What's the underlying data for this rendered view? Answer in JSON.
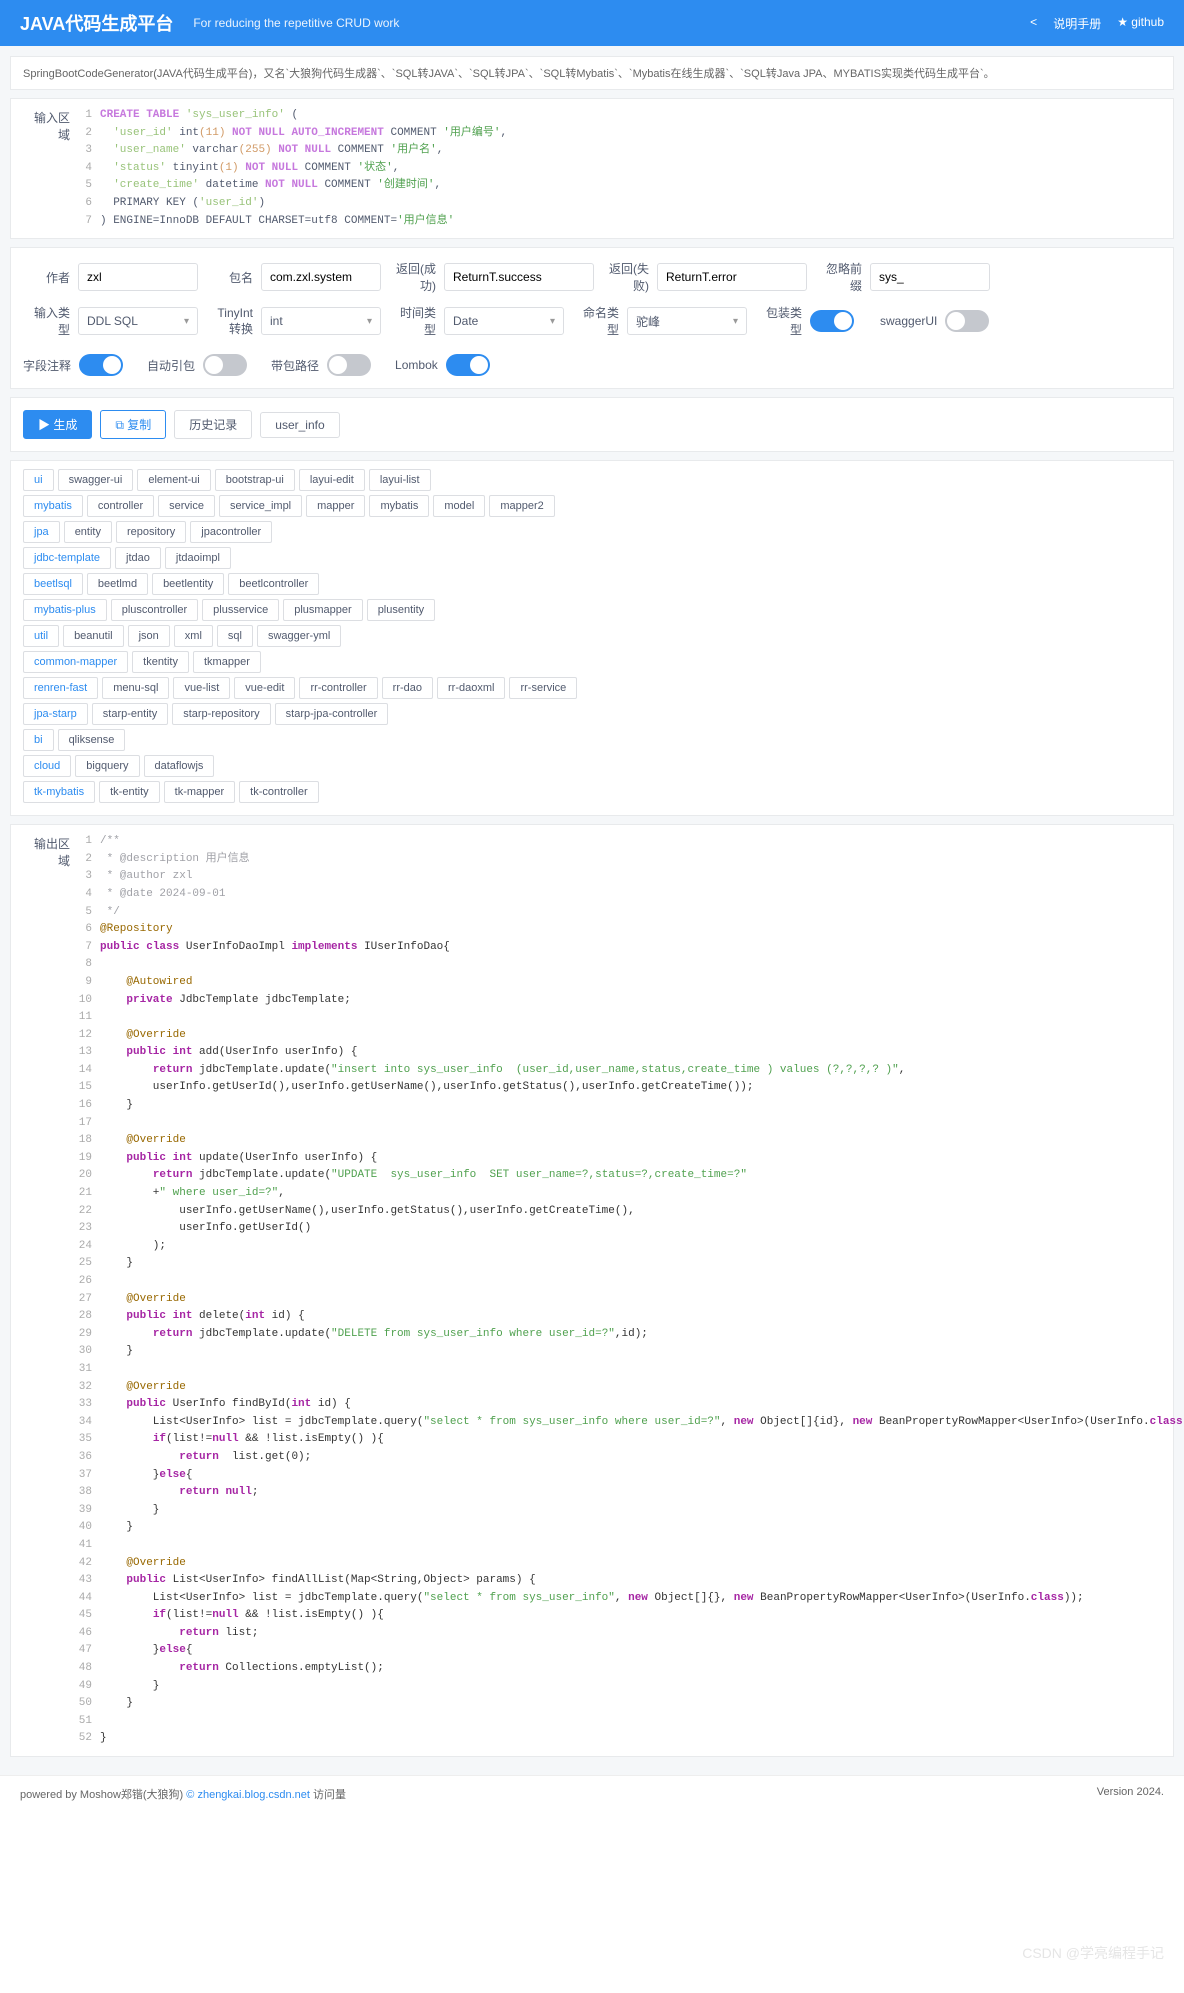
{
  "header": {
    "title": "JAVA代码生成平台",
    "subtitle": "For reducing the repetitive CRUD work",
    "manual": "说明手册",
    "github": "github",
    "shareIcon": "<"
  },
  "desc": "SpringBootCodeGenerator(JAVA代码生成平台)，又名`大狼狗代码生成器`、`SQL转JAVA`、`SQL转JPA`、`SQL转Mybatis`、`Mybatis在线生成器`、`SQL转Java JPA、MYBATIS实现类代码生成平台`。",
  "inputArea": {
    "label": "输入区域",
    "lines": [
      [
        {
          "t": "CREATE TABLE ",
          "c": "kw"
        },
        {
          "t": "'sys_user_info'",
          "c": "str"
        },
        {
          "t": " (",
          "c": ""
        }
      ],
      [
        {
          "t": "  ",
          "c": ""
        },
        {
          "t": "'user_id'",
          "c": "str"
        },
        {
          "t": " int",
          "c": ""
        },
        {
          "t": "(11)",
          "c": "num"
        },
        {
          "t": " NOT NULL AUTO_INCREMENT",
          "c": "kw"
        },
        {
          "t": " COMMENT ",
          "c": ""
        },
        {
          "t": "'用户编号'",
          "c": "str2"
        },
        {
          "t": ",",
          "c": ""
        }
      ],
      [
        {
          "t": "  ",
          "c": ""
        },
        {
          "t": "'user_name'",
          "c": "str"
        },
        {
          "t": " varchar",
          "c": ""
        },
        {
          "t": "(255)",
          "c": "num"
        },
        {
          "t": " NOT NULL",
          "c": "kw"
        },
        {
          "t": " COMMENT ",
          "c": ""
        },
        {
          "t": "'用户名'",
          "c": "str2"
        },
        {
          "t": ",",
          "c": ""
        }
      ],
      [
        {
          "t": "  ",
          "c": ""
        },
        {
          "t": "'status'",
          "c": "str"
        },
        {
          "t": " tinyint",
          "c": ""
        },
        {
          "t": "(1)",
          "c": "num"
        },
        {
          "t": " NOT NULL",
          "c": "kw"
        },
        {
          "t": " COMMENT ",
          "c": ""
        },
        {
          "t": "'状态'",
          "c": "str2"
        },
        {
          "t": ",",
          "c": ""
        }
      ],
      [
        {
          "t": "  ",
          "c": ""
        },
        {
          "t": "'create_time'",
          "c": "str"
        },
        {
          "t": " datetime ",
          "c": ""
        },
        {
          "t": "NOT NULL",
          "c": "kw"
        },
        {
          "t": " COMMENT ",
          "c": ""
        },
        {
          "t": "'创建时间'",
          "c": "str2"
        },
        {
          "t": ",",
          "c": ""
        }
      ],
      [
        {
          "t": "  PRIMARY KEY (",
          "c": ""
        },
        {
          "t": "'user_id'",
          "c": "str"
        },
        {
          "t": ")",
          "c": ""
        }
      ],
      [
        {
          "t": ") ENGINE=InnoDB DEFAULT CHARSET=utf8 COMMENT=",
          "c": ""
        },
        {
          "t": "'用户信息'",
          "c": "str2"
        }
      ]
    ]
  },
  "form": {
    "author": {
      "label": "作者",
      "value": "zxl"
    },
    "package": {
      "label": "包名",
      "value": "com.zxl.system"
    },
    "returnSuccess": {
      "label": "返回(成功)",
      "value": "ReturnT.success"
    },
    "returnFail": {
      "label": "返回(失败)",
      "value": "ReturnT.error"
    },
    "ignorePrefix": {
      "label": "忽略前缀",
      "value": "sys_"
    },
    "inputType": {
      "label": "输入类型",
      "value": "DDL SQL"
    },
    "tinyint": {
      "label": "TinyInt转换",
      "value": "int"
    },
    "timeType": {
      "label": "时间类型",
      "value": "Date"
    },
    "nameType": {
      "label": "命名类型",
      "value": "驼峰"
    },
    "packageType": {
      "label": "包装类型"
    },
    "swagger": {
      "label": "swaggerUI"
    },
    "fieldComment": {
      "label": "字段注释"
    },
    "autoImport": {
      "label": "自动引包"
    },
    "withPath": {
      "label": "带包路径"
    },
    "lombok": {
      "label": "Lombok"
    }
  },
  "buttons": {
    "generate": "▶ 生成",
    "copy": "⧉ 复制",
    "history": "历史记录",
    "userinfo": "user_info"
  },
  "tabGroups": [
    {
      "head": "ui",
      "items": [
        "swagger-ui",
        "element-ui",
        "bootstrap-ui",
        "layui-edit",
        "layui-list"
      ]
    },
    {
      "head": "mybatis",
      "items": [
        "controller",
        "service",
        "service_impl",
        "mapper",
        "mybatis",
        "model",
        "mapper2"
      ]
    },
    {
      "head": "jpa",
      "items": [
        "entity",
        "repository",
        "jpacontroller"
      ]
    },
    {
      "head": "jdbc-template",
      "items": [
        "jtdao",
        "jtdaoimpl"
      ]
    },
    {
      "head": "beetlsql",
      "items": [
        "beetlmd",
        "beetlentity",
        "beetlcontroller"
      ]
    },
    {
      "head": "mybatis-plus",
      "items": [
        "pluscontroller",
        "plusservice",
        "plusmapper",
        "plusentity"
      ]
    },
    {
      "head": "util",
      "items": [
        "beanutil",
        "json",
        "xml",
        "sql",
        "swagger-yml"
      ]
    },
    {
      "head": "common-mapper",
      "items": [
        "tkentity",
        "tkmapper"
      ]
    },
    {
      "head": "renren-fast",
      "items": [
        "menu-sql",
        "vue-list",
        "vue-edit",
        "rr-controller",
        "rr-dao",
        "rr-daoxml",
        "rr-service"
      ]
    },
    {
      "head": "jpa-starp",
      "items": [
        "starp-entity",
        "starp-repository",
        "starp-jpa-controller"
      ]
    },
    {
      "head": "bi",
      "items": [
        "qliksense"
      ]
    },
    {
      "head": "cloud",
      "items": [
        "bigquery",
        "dataflowjs"
      ]
    },
    {
      "head": "tk-mybatis",
      "items": [
        "tk-entity",
        "tk-mapper",
        "tk-controller"
      ]
    }
  ],
  "outputArea": {
    "label": "输出区域",
    "lines": [
      "/**",
      " * @description 用户信息",
      " * @author zxl",
      " * @date 2024-09-01",
      " */",
      "@Repository",
      "public class UserInfoDaoImpl implements IUserInfoDao{",
      "",
      "    @Autowired",
      "    private JdbcTemplate jdbcTemplate;",
      "",
      "    @Override",
      "    public int add(UserInfo userInfo) {",
      "        return jdbcTemplate.update(\"insert into sys_user_info  (user_id,user_name,status,create_time ) values (?,?,?,? )\",",
      "        userInfo.getUserId(),userInfo.getUserName(),userInfo.getStatus(),userInfo.getCreateTime());",
      "    }",
      "",
      "    @Override",
      "    public int update(UserInfo userInfo) {",
      "        return jdbcTemplate.update(\"UPDATE  sys_user_info  SET user_name=?,status=?,create_time=?\"",
      "        +\" where user_id=?\",",
      "            userInfo.getUserName(),userInfo.getStatus(),userInfo.getCreateTime(),",
      "            userInfo.getUserId()",
      "        );",
      "    }",
      "",
      "    @Override",
      "    public int delete(int id) {",
      "        return jdbcTemplate.update(\"DELETE from sys_user_info where user_id=?\",id);",
      "    }",
      "",
      "    @Override",
      "    public UserInfo findById(int id) {",
      "        List<UserInfo> list = jdbcTemplate.query(\"select * from sys_user_info where user_id=?\", new Object[]{id}, new BeanPropertyRowMapper<UserInfo>(UserInfo.class));",
      "        if(list!=null && !list.isEmpty() ){",
      "            return  list.get(0);",
      "        }else{",
      "            return null;",
      "        }",
      "    }",
      "",
      "    @Override",
      "    public List<UserInfo> findAllList(Map<String,Object> params) {",
      "        List<UserInfo> list = jdbcTemplate.query(\"select * from sys_user_info\", new Object[]{}, new BeanPropertyRowMapper<UserInfo>(UserInfo.class));",
      "        if(list!=null && !list.isEmpty() ){",
      "            return list;",
      "        }else{",
      "            return Collections.emptyList();",
      "        }",
      "    }",
      "",
      "}"
    ]
  },
  "footer": {
    "left": "powered by Moshow郑锴(大狼狗) ",
    "link": "zhengkai.blog.csdn.net",
    "visit": " 访问量",
    "version": "Version 2024."
  },
  "watermark": "CSDN @学亮编程手记"
}
